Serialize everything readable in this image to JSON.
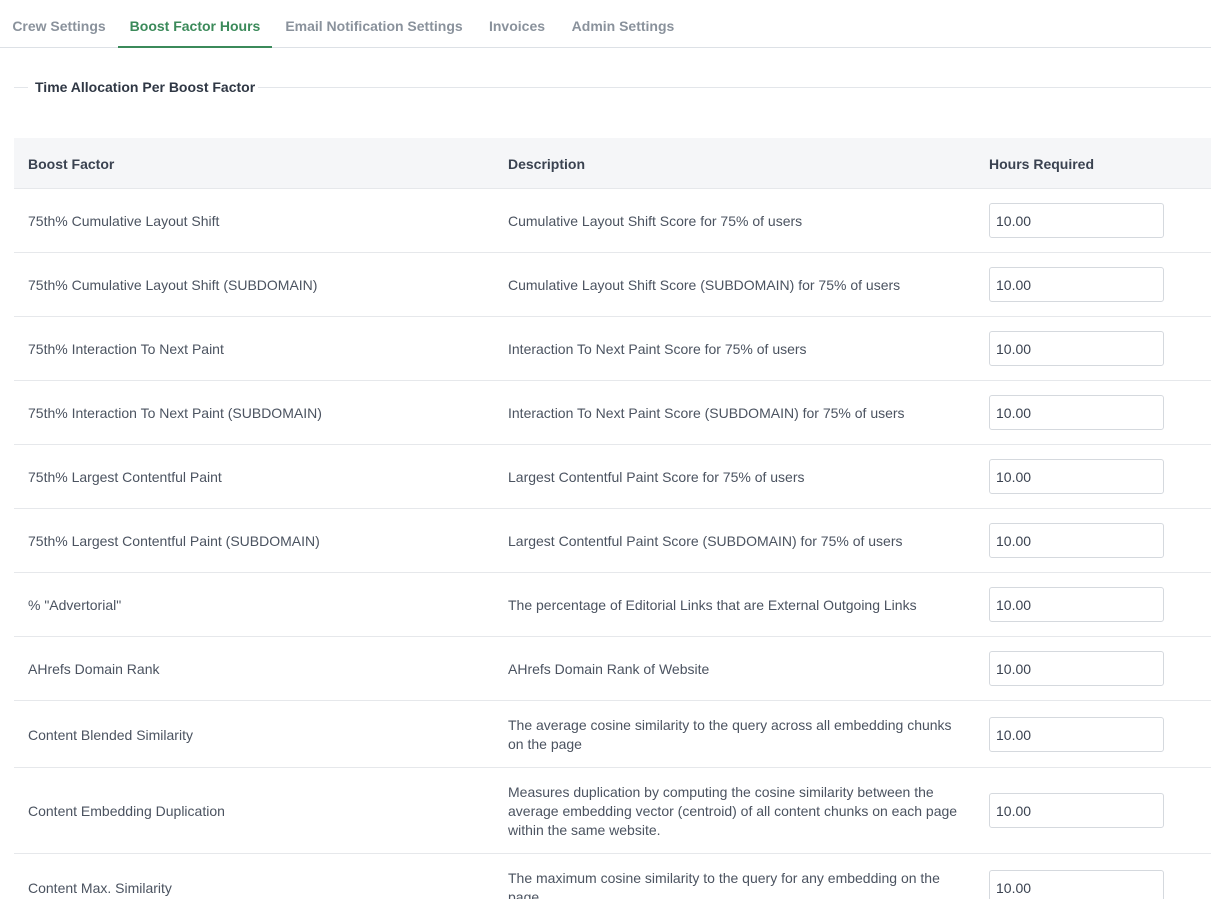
{
  "tabs": [
    {
      "label": "Crew Settings",
      "active": false
    },
    {
      "label": "Boost Factor Hours",
      "active": true
    },
    {
      "label": "Email Notification Settings",
      "active": false
    },
    {
      "label": "Invoices",
      "active": false
    },
    {
      "label": "Admin Settings",
      "active": false
    }
  ],
  "section": {
    "legend": "Time Allocation Per Boost Factor"
  },
  "table": {
    "headers": {
      "boost_factor": "Boost Factor",
      "description": "Description",
      "hours_required": "Hours Required"
    },
    "rows": [
      {
        "factor": "75th% Cumulative Layout Shift",
        "description": "Cumulative Layout Shift Score for 75% of users",
        "hours": "10.00"
      },
      {
        "factor": "75th% Cumulative Layout Shift (SUBDOMAIN)",
        "description": "Cumulative Layout Shift Score (SUBDOMAIN) for 75% of users",
        "hours": "10.00"
      },
      {
        "factor": "75th% Interaction To Next Paint",
        "description": "Interaction To Next Paint Score for 75% of users",
        "hours": "10.00"
      },
      {
        "factor": "75th% Interaction To Next Paint (SUBDOMAIN)",
        "description": "Interaction To Next Paint Score (SUBDOMAIN) for 75% of users",
        "hours": "10.00"
      },
      {
        "factor": "75th% Largest Contentful Paint",
        "description": "Largest Contentful Paint Score for 75% of users",
        "hours": "10.00"
      },
      {
        "factor": "75th% Largest Contentful Paint (SUBDOMAIN)",
        "description": "Largest Contentful Paint Score (SUBDOMAIN) for 75% of users",
        "hours": "10.00"
      },
      {
        "factor": "% \"Advertorial\"",
        "description": "The percentage of Editorial Links that are External Outgoing Links",
        "hours": "10.00"
      },
      {
        "factor": "AHrefs Domain Rank",
        "description": "AHrefs Domain Rank of Website",
        "hours": "10.00"
      },
      {
        "factor": "Content Blended Similarity",
        "description": "The average cosine similarity to the query across all embedding chunks on the page",
        "hours": "10.00"
      },
      {
        "factor": "Content Embedding Duplication",
        "description": "Measures duplication by computing the cosine similarity between the average embedding vector (centroid) of all content chunks on each page within the same website.",
        "hours": "10.00"
      },
      {
        "factor": "Content Max. Similarity",
        "description": "The maximum cosine similarity to the query for any embedding on the page",
        "hours": "10.00"
      }
    ]
  }
}
